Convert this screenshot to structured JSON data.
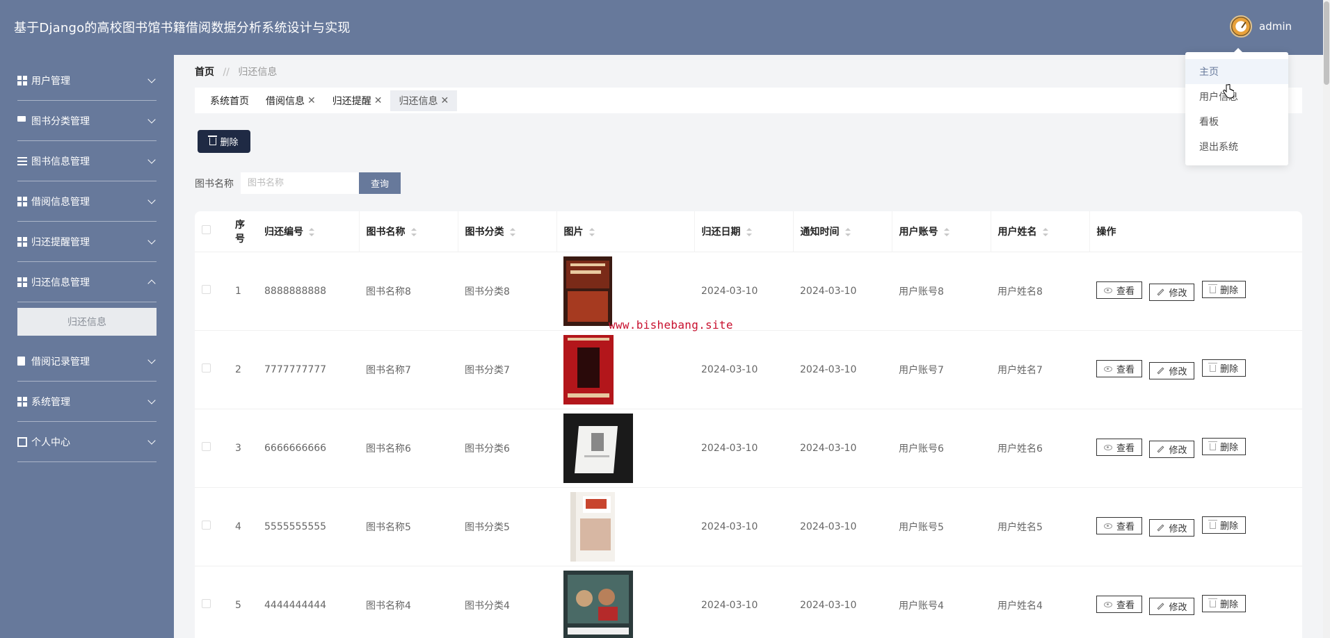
{
  "app": {
    "title": "基于Django的高校图书馆书籍借阅数据分析系统设计与实现",
    "username": "admin"
  },
  "sidebar": {
    "items": [
      {
        "label": "用户管理",
        "icon": "grid-icon"
      },
      {
        "label": "图书分类管理",
        "icon": "flag-icon"
      },
      {
        "label": "图书信息管理",
        "icon": "list-icon"
      },
      {
        "label": "借阅信息管理",
        "icon": "grid-icon"
      },
      {
        "label": "归还提醒管理",
        "icon": "table-icon"
      },
      {
        "label": "归还信息管理",
        "icon": "grid-icon",
        "expanded": true,
        "sub": "归还信息"
      },
      {
        "label": "借阅记录管理",
        "icon": "clipboard-icon"
      },
      {
        "label": "系统管理",
        "icon": "grid-icon"
      },
      {
        "label": "个人中心",
        "icon": "window-icon"
      }
    ]
  },
  "breadcrumb": {
    "home": "首页",
    "sep": "//",
    "current": "归还信息"
  },
  "tabs": [
    {
      "label": "系统首页",
      "closable": false
    },
    {
      "label": "借阅信息",
      "closable": true
    },
    {
      "label": "归还提醒",
      "closable": true
    },
    {
      "label": "归还信息",
      "closable": true,
      "active": true
    }
  ],
  "toolbar": {
    "delete_label": "删除"
  },
  "search": {
    "label": "图书名称",
    "placeholder": "图书名称",
    "value": "",
    "button": "查询"
  },
  "table": {
    "columns": [
      "序号",
      "归还编号",
      "图书名称",
      "图书分类",
      "图片",
      "归还日期",
      "通知时间",
      "用户账号",
      "用户姓名",
      "操作"
    ],
    "rows": [
      {
        "idx": "1",
        "no": "8888888888",
        "name": "图书名称8",
        "cat": "图书分类8",
        "img": "red-book",
        "ret": "2024-03-10",
        "notify": "2024-03-10",
        "acct": "用户账号8",
        "user": "用户姓名8"
      },
      {
        "idx": "2",
        "no": "7777777777",
        "name": "图书名称7",
        "cat": "图书分类7",
        "img": "red-cover",
        "ret": "2024-03-10",
        "notify": "2024-03-10",
        "acct": "用户账号7",
        "user": "用户姓名7"
      },
      {
        "idx": "3",
        "no": "6666666666",
        "name": "图书名称6",
        "cat": "图书分类6",
        "img": "white-book",
        "ret": "2024-03-10",
        "notify": "2024-03-10",
        "acct": "用户账号6",
        "user": "用户姓名6"
      },
      {
        "idx": "4",
        "no": "5555555555",
        "name": "图书名称5",
        "cat": "图书分类5",
        "img": "reader-book",
        "ret": "2024-03-10",
        "notify": "2024-03-10",
        "acct": "用户账号5",
        "user": "用户姓名5"
      },
      {
        "idx": "5",
        "no": "4444444444",
        "name": "图书名称4",
        "cat": "图书分类4",
        "img": "photo-book",
        "ret": "2024-03-10",
        "notify": "2024-03-10",
        "acct": "用户账号4",
        "user": "用户姓名4"
      }
    ],
    "actions": {
      "view": "查看",
      "edit": "修改",
      "delete": "删除"
    }
  },
  "dropdown": {
    "items": [
      "主页",
      "用户信息",
      "看板",
      "退出系统"
    ]
  },
  "watermark": "www.bishebang.site",
  "colors": {
    "header": "#67799b",
    "sidebar": "#67799b",
    "primary_dark": "#1f2a44",
    "watermark": "#c8102e"
  }
}
